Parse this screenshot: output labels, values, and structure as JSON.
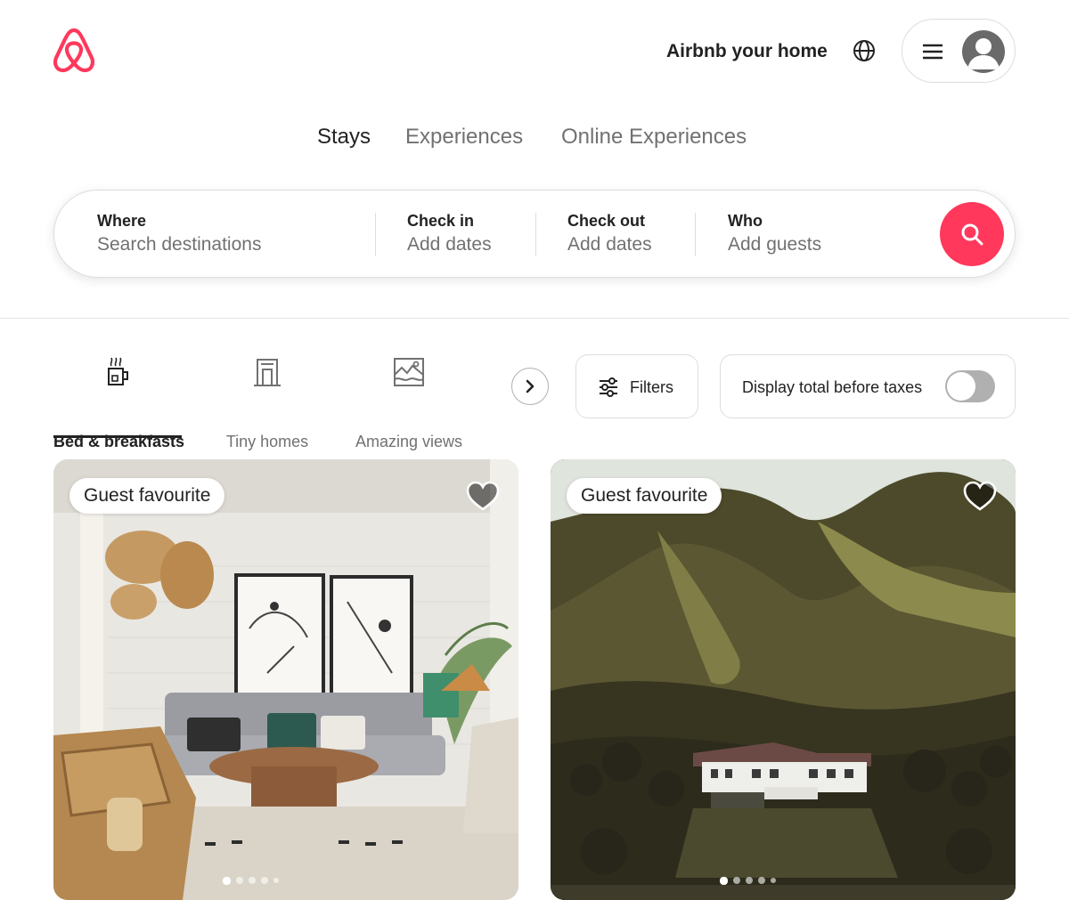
{
  "brand": {
    "name": "Airbnb",
    "color": "#FF385C",
    "icon": "airbnb-logo"
  },
  "header": {
    "host_link": "Airbnb your home",
    "globe_icon": "globe-icon",
    "menu_icon": "hamburger-icon",
    "avatar_icon": "user-avatar-icon"
  },
  "tabs": [
    {
      "label": "Stays",
      "active": true
    },
    {
      "label": "Experiences",
      "active": false
    },
    {
      "label": "Online Experiences",
      "active": false
    }
  ],
  "search": {
    "where": {
      "label": "Where",
      "placeholder": "Search destinations"
    },
    "check_in": {
      "label": "Check in",
      "placeholder": "Add dates"
    },
    "check_out": {
      "label": "Check out",
      "placeholder": "Add dates"
    },
    "who": {
      "label": "Who",
      "placeholder": "Add guests"
    },
    "button_icon": "search-icon"
  },
  "categories": [
    {
      "label": "Bed & breakfasts",
      "icon": "bed-breakfast-icon",
      "active": true
    },
    {
      "label": "Tiny homes",
      "icon": "tiny-home-icon",
      "active": false
    },
    {
      "label": "Amazing views",
      "icon": "amazing-views-icon",
      "active": false
    }
  ],
  "filters": {
    "label": "Filters",
    "icon": "sliders-icon"
  },
  "tax_toggle": {
    "label": "Display total before taxes",
    "on": false
  },
  "listings": [
    {
      "badge": "Guest favourite",
      "image": "living room with rattan lamps and abstract art",
      "photo_count": 5,
      "current_photo": 1
    },
    {
      "badge": "Guest favourite",
      "image": "white villa at the foot of a forested hill",
      "photo_count": 5,
      "current_photo": 1
    }
  ]
}
